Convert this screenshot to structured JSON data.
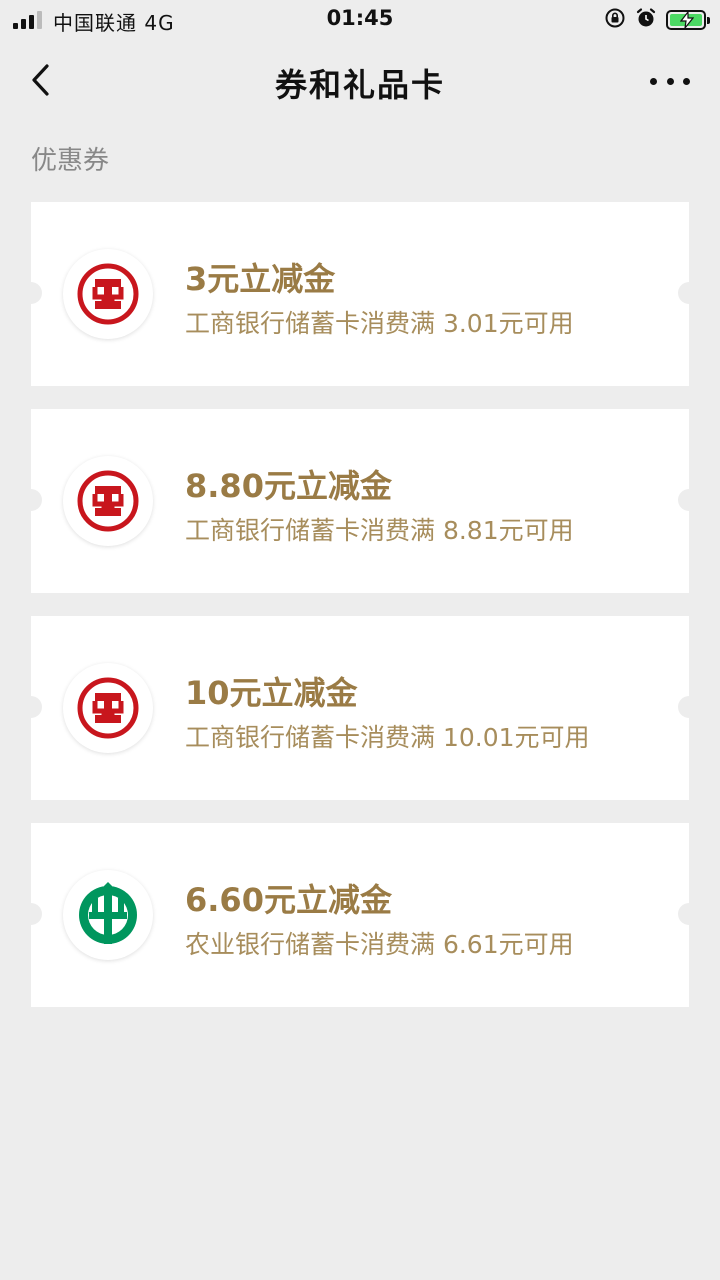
{
  "status_bar": {
    "carrier": "中国联通  4G",
    "time": "01:45",
    "icons": [
      "signal-icon",
      "orientation-lock-icon",
      "alarm-icon",
      "battery-charging-icon"
    ]
  },
  "nav": {
    "title": "券和礼品卡",
    "back_icon": "chevron-left-icon",
    "more_icon": "more-dots-icon"
  },
  "section": {
    "label": "优惠券"
  },
  "colors": {
    "coupon_title": "#9a7b45",
    "coupon_desc": "#a78d5c",
    "icbc_red": "#c8161d",
    "abc_green": "#00965e",
    "page_bg": "#ededed"
  },
  "coupons": [
    {
      "title": "3元立减金",
      "desc": "工商银行储蓄卡消费满 3.01元可用",
      "bank_icon": "icbc-logo-icon"
    },
    {
      "title": "8.80元立减金",
      "desc": "工商银行储蓄卡消费满 8.81元可用",
      "bank_icon": "icbc-logo-icon"
    },
    {
      "title": "10元立减金",
      "desc": "工商银行储蓄卡消费满 10.01元可用",
      "bank_icon": "icbc-logo-icon"
    },
    {
      "title": "6.60元立减金",
      "desc": "农业银行储蓄卡消费满 6.61元可用",
      "bank_icon": "abc-logo-icon"
    }
  ]
}
